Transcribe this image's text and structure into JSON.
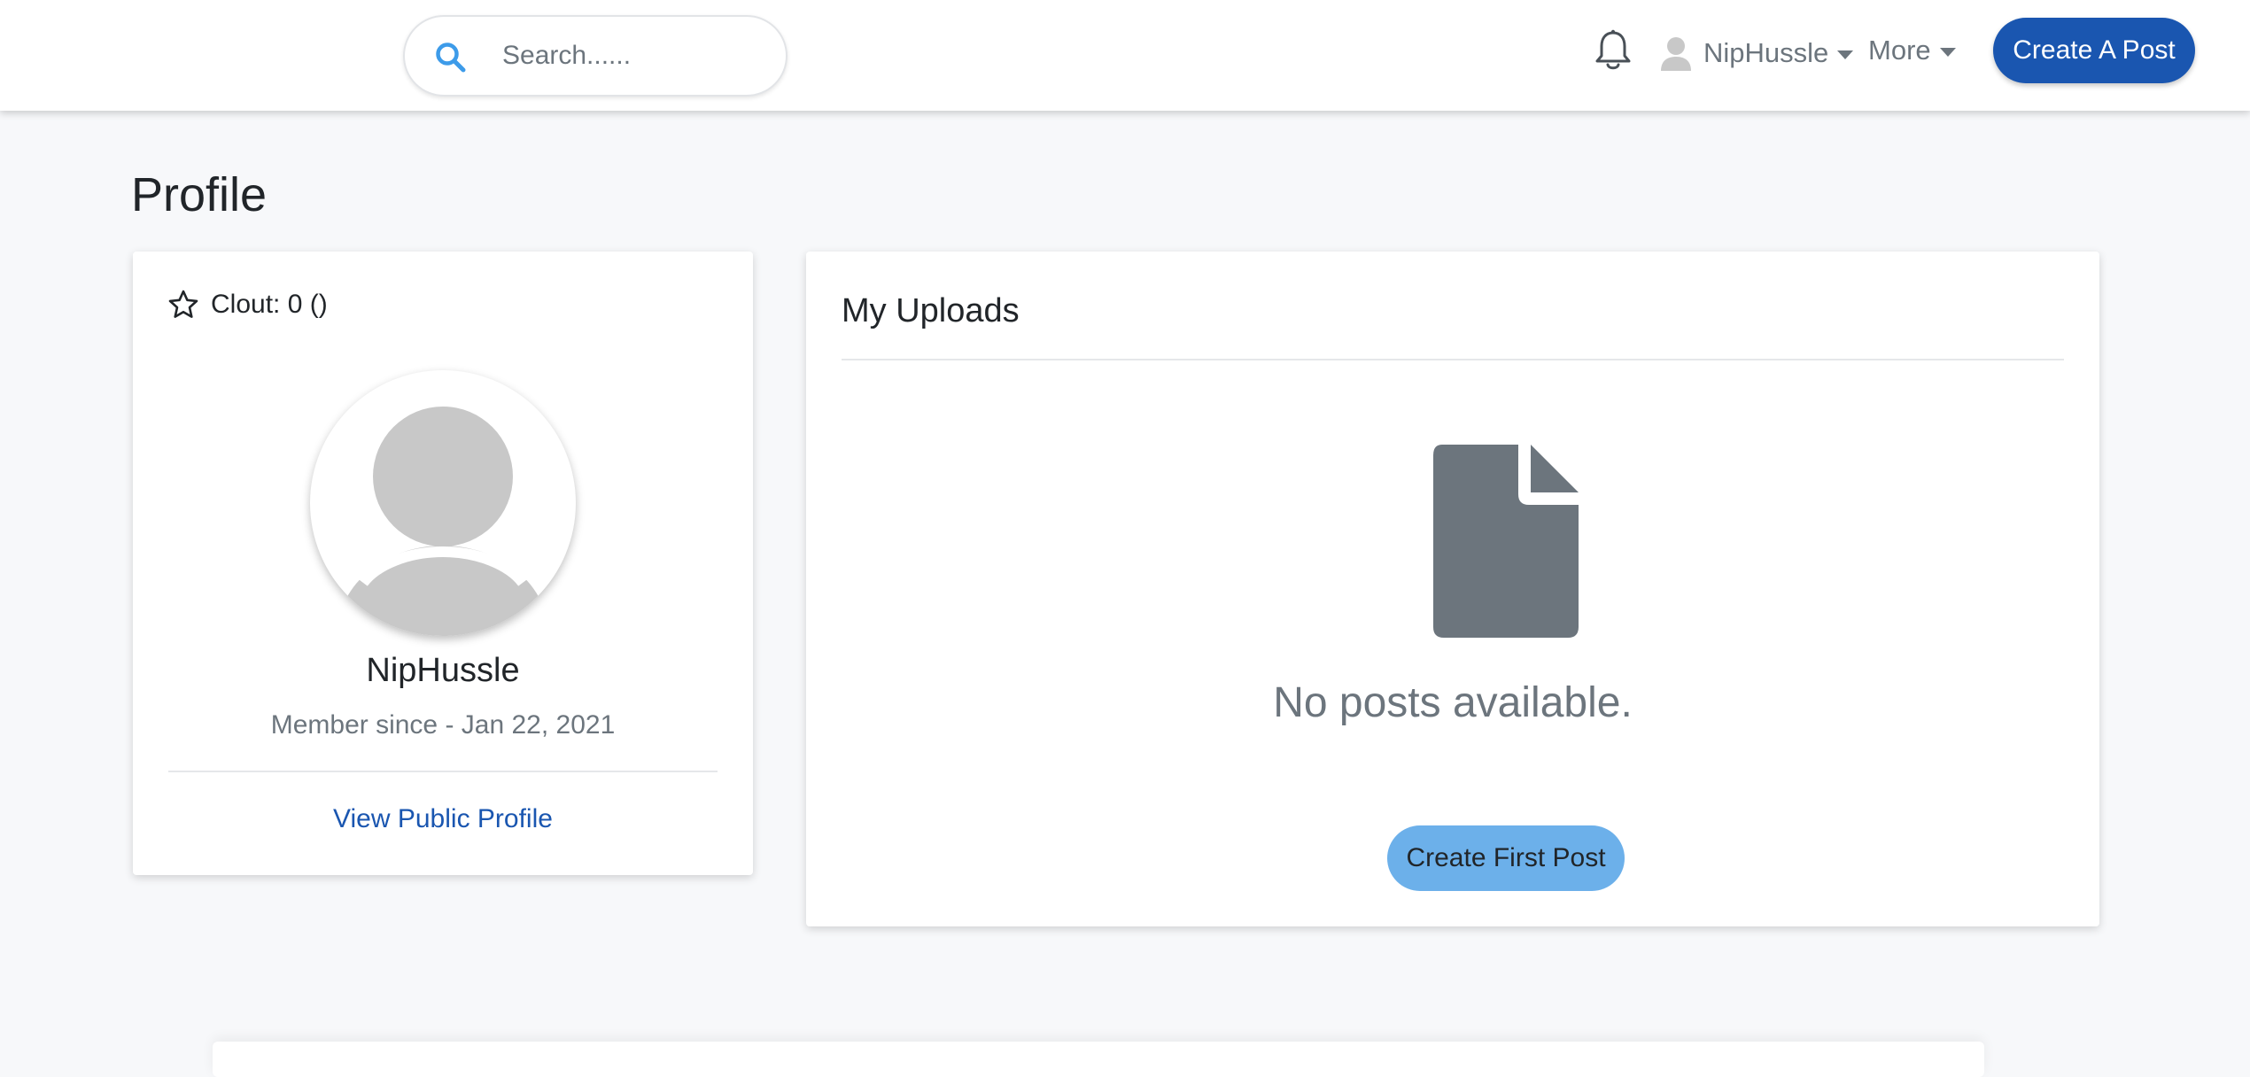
{
  "header": {
    "search": {
      "placeholder": "Search......"
    },
    "notifications": {
      "icon": "bell-icon"
    },
    "user_menu": {
      "username": "NipHussle",
      "avatar_icon": "user-silhouette-icon",
      "caret_icon": "caret-down-icon"
    },
    "more_menu": {
      "label": "More",
      "caret_icon": "caret-down-icon"
    },
    "create_post_button": {
      "label": "Create A Post",
      "color": "#1a56b0"
    }
  },
  "page": {
    "title": "Profile"
  },
  "profile_card": {
    "clout_icon": "star-outline-icon",
    "clout_text": "Clout: 0 ()",
    "avatar_icon": "default-avatar-icon",
    "name": "NipHussle",
    "member_since": "Member since - Jan 22, 2021",
    "view_public_profile_link": "View Public Profile",
    "link_color": "#1a56b0"
  },
  "uploads_card": {
    "title": "My Uploads",
    "empty_icon": "file-icon",
    "empty_message": "No posts available.",
    "create_first_post_button": {
      "label": "Create First Post",
      "color": "#6cb0ea"
    }
  },
  "colors": {
    "page_background": "#f7f8fa",
    "muted_text": "#6c757d",
    "file_icon_fill": "#6c757d"
  }
}
